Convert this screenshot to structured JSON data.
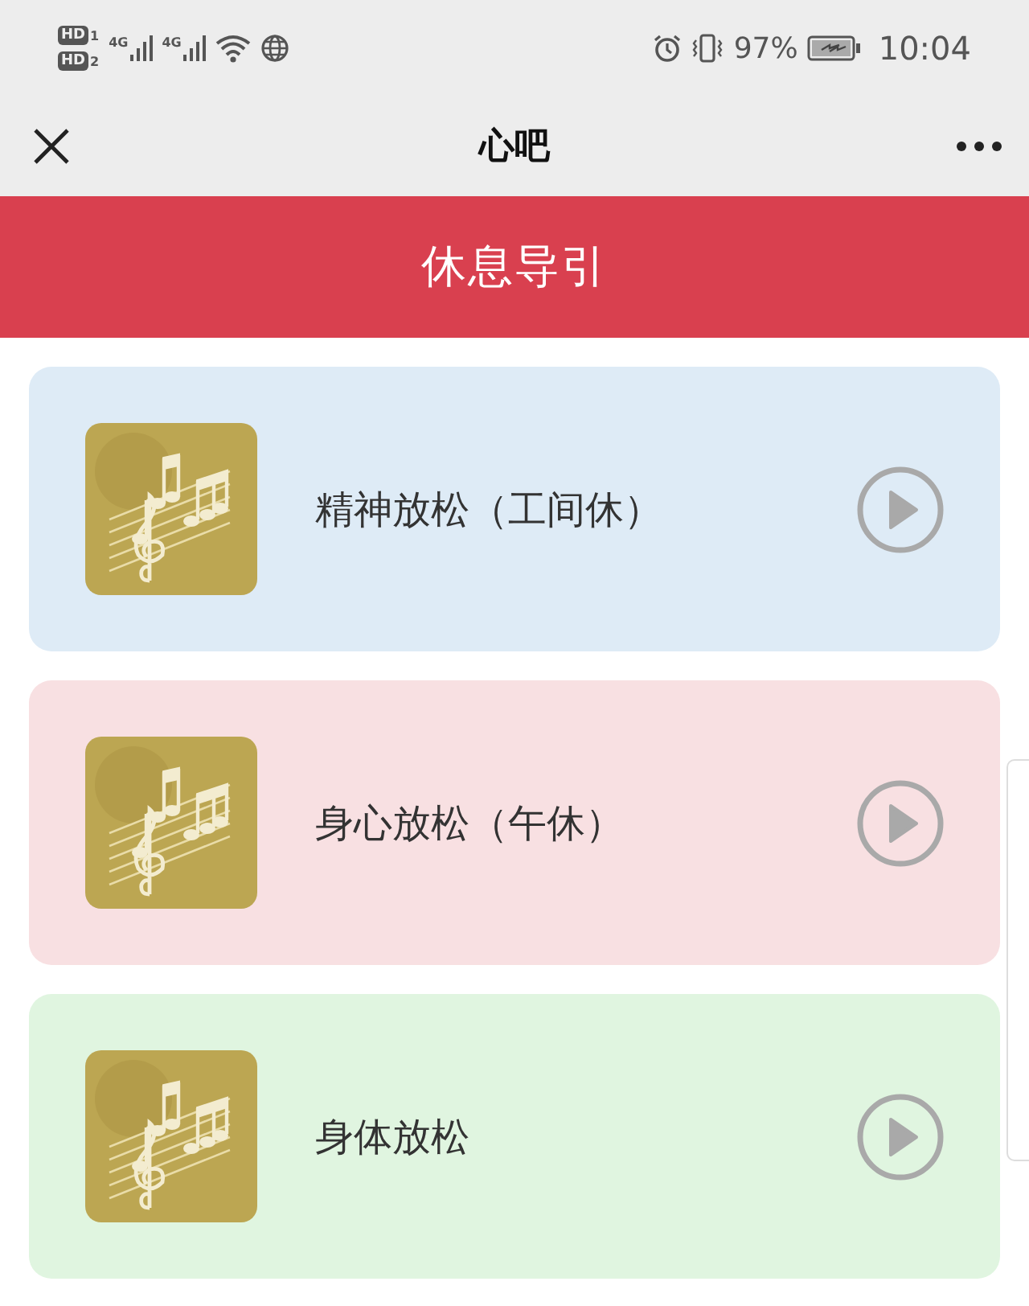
{
  "status_bar": {
    "sims": [
      {
        "badge": "HD",
        "slot": "1",
        "network": "4G"
      },
      {
        "badge": "HD",
        "slot": "2",
        "network": "4G"
      }
    ],
    "battery": "97%",
    "time": "10:04"
  },
  "nav": {
    "title": "心吧"
  },
  "banner": {
    "title": "休息导引"
  },
  "tracks": [
    {
      "title": "精神放松（工间休）",
      "color": "#deebf6"
    },
    {
      "title": "身心放松（午休）",
      "color": "#f8e0e2"
    },
    {
      "title": "身体放松",
      "color": "#e0f5e0"
    }
  ]
}
